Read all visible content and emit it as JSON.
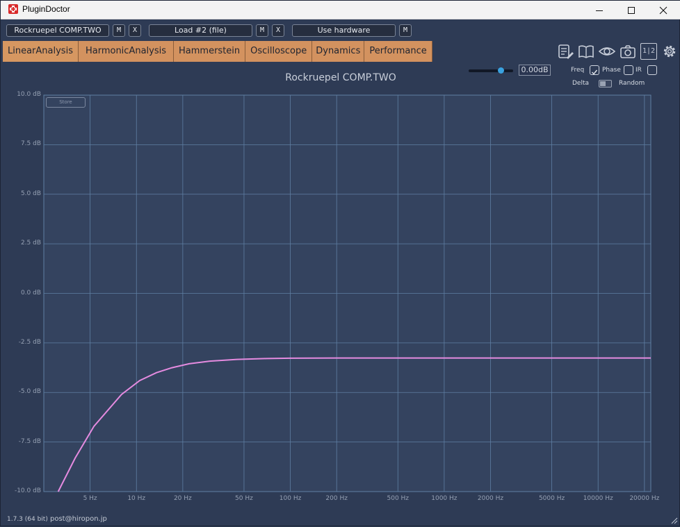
{
  "window": {
    "title": "PluginDoctor",
    "minimize_icon": "minimize-icon",
    "maximize_icon": "maximize-icon",
    "close_icon": "close-icon"
  },
  "toolbar": {
    "plugin_slot": "Rockruepel COMP.TWO",
    "plugin_m": "M",
    "plugin_x": "X",
    "load_slot": "Load #2 (file)",
    "load_m": "M",
    "load_x": "X",
    "hardware_slot": "Use hardware",
    "hardware_m": "M"
  },
  "tabs": [
    {
      "label": "LinearAnalysis"
    },
    {
      "label": "HarmonicAnalysis"
    },
    {
      "label": "Hammerstein"
    },
    {
      "label": "Oscilloscope"
    },
    {
      "label": "Dynamics"
    },
    {
      "label": "Performance"
    }
  ],
  "tool_icons": [
    "notes-icon",
    "book-icon",
    "eye-icon",
    "camera-icon",
    "split-1-2-icon",
    "gear-icon"
  ],
  "tool_icon_split_text": "1|2",
  "controls": {
    "gain_value": "0.00dB",
    "gain_level": 0.72,
    "freq_label": "Freq",
    "freq_checked": true,
    "phase_label": "Phase",
    "phase_checked": false,
    "ir_label": "IR",
    "ir_checked": false,
    "delta_label": "Delta",
    "random_label": "Random",
    "random_enabled": false
  },
  "plot": {
    "title": "Rockruepel COMP.TWO",
    "store_label": "Store",
    "curve_color": "#e58be0",
    "grid_color": "#5f7fa3",
    "bg_color": "#34435f"
  },
  "chart_data": {
    "type": "line",
    "title": "Rockruepel COMP.TWO",
    "xlabel": "",
    "ylabel": "",
    "xscale": "log",
    "ylim": [
      -10,
      10
    ],
    "xlim": [
      2.5,
      22000
    ],
    "yticks": [
      "10.0 dB",
      "7.5 dB",
      "5.0 dB",
      "2.5 dB",
      "0.0 dB",
      "-2.5 dB",
      "-5.0 dB",
      "-7.5 dB",
      "-10.0 dB"
    ],
    "xticks": [
      "5 Hz",
      "10 Hz",
      "20 Hz",
      "50 Hz",
      "100 Hz",
      "200 Hz",
      "500 Hz",
      "1000 Hz",
      "2000 Hz",
      "5000 Hz",
      "10000 Hz",
      "20000 Hz"
    ],
    "grid": true,
    "series": [
      {
        "x": [
          3.1,
          4,
          5.3,
          8,
          10.5,
          13.5,
          17,
          22,
          30,
          45,
          70,
          100,
          200,
          500,
          1000,
          2000,
          5000,
          10000,
          20000,
          22000
        ],
        "y": [
          -10,
          -8.3,
          -6.7,
          -5.1,
          -4.4,
          -4.0,
          -3.75,
          -3.55,
          -3.42,
          -3.33,
          -3.29,
          -3.27,
          -3.26,
          -3.26,
          -3.26,
          -3.26,
          -3.26,
          -3.26,
          -3.26,
          -3.26
        ]
      }
    ]
  },
  "footer": {
    "version": "1.7.3 (64 bit)",
    "email": "post@hiropon.jp"
  }
}
